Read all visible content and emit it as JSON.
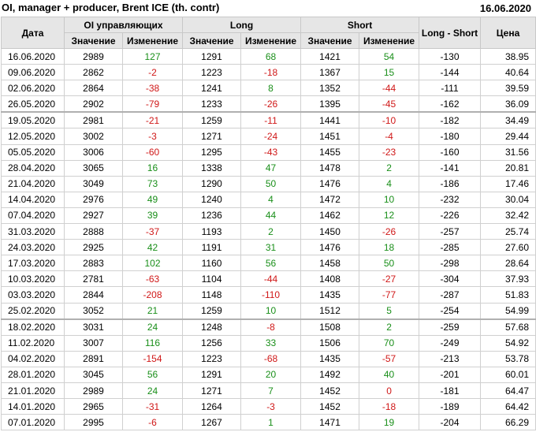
{
  "title": "OI, manager + producer, Brent ICE (th. contr)",
  "date": "16.06.2020",
  "headers": {
    "date": "Дата",
    "oi_group": "OI управляющих",
    "long_group": "Long",
    "short_group": "Short",
    "long_short": "Long - Short",
    "price": "Цена",
    "value": "Значение",
    "change": "Изменение"
  },
  "colors": {
    "positive": "#1a8f1a",
    "negative": "#d01818",
    "header_bg": "#e6e6e6"
  },
  "rows": [
    {
      "date": "16.06.2020",
      "oi": "2989",
      "oi_chg": "127",
      "long": "1291",
      "long_chg": "68",
      "short": "1421",
      "short_chg": "54",
      "ls": "-130",
      "price": "38.95"
    },
    {
      "date": "09.06.2020",
      "oi": "2862",
      "oi_chg": "-2",
      "long": "1223",
      "long_chg": "-18",
      "short": "1367",
      "short_chg": "15",
      "ls": "-144",
      "price": "40.64"
    },
    {
      "date": "02.06.2020",
      "oi": "2864",
      "oi_chg": "-38",
      "long": "1241",
      "long_chg": "8",
      "short": "1352",
      "short_chg": "-44",
      "ls": "-111",
      "price": "39.59"
    },
    {
      "date": "26.05.2020",
      "oi": "2902",
      "oi_chg": "-79",
      "long": "1233",
      "long_chg": "-26",
      "short": "1395",
      "short_chg": "-45",
      "ls": "-162",
      "price": "36.09"
    },
    {
      "date": "19.05.2020",
      "oi": "2981",
      "oi_chg": "-21",
      "long": "1259",
      "long_chg": "-11",
      "short": "1441",
      "short_chg": "-10",
      "ls": "-182",
      "price": "34.49"
    },
    {
      "date": "12.05.2020",
      "oi": "3002",
      "oi_chg": "-3",
      "long": "1271",
      "long_chg": "-24",
      "short": "1451",
      "short_chg": "-4",
      "ls": "-180",
      "price": "29.44"
    },
    {
      "date": "05.05.2020",
      "oi": "3006",
      "oi_chg": "-60",
      "long": "1295",
      "long_chg": "-43",
      "short": "1455",
      "short_chg": "-23",
      "ls": "-160",
      "price": "31.56"
    },
    {
      "date": "28.04.2020",
      "oi": "3065",
      "oi_chg": "16",
      "long": "1338",
      "long_chg": "47",
      "short": "1478",
      "short_chg": "2",
      "ls": "-141",
      "price": "20.81"
    },
    {
      "date": "21.04.2020",
      "oi": "3049",
      "oi_chg": "73",
      "long": "1290",
      "long_chg": "50",
      "short": "1476",
      "short_chg": "4",
      "ls": "-186",
      "price": "17.46"
    },
    {
      "date": "14.04.2020",
      "oi": "2976",
      "oi_chg": "49",
      "long": "1240",
      "long_chg": "4",
      "short": "1472",
      "short_chg": "10",
      "ls": "-232",
      "price": "30.04"
    },
    {
      "date": "07.04.2020",
      "oi": "2927",
      "oi_chg": "39",
      "long": "1236",
      "long_chg": "44",
      "short": "1462",
      "short_chg": "12",
      "ls": "-226",
      "price": "32.42"
    },
    {
      "date": "31.03.2020",
      "oi": "2888",
      "oi_chg": "-37",
      "long": "1193",
      "long_chg": "2",
      "short": "1450",
      "short_chg": "-26",
      "ls": "-257",
      "price": "25.74"
    },
    {
      "date": "24.03.2020",
      "oi": "2925",
      "oi_chg": "42",
      "long": "1191",
      "long_chg": "31",
      "short": "1476",
      "short_chg": "18",
      "ls": "-285",
      "price": "27.60"
    },
    {
      "date": "17.03.2020",
      "oi": "2883",
      "oi_chg": "102",
      "long": "1160",
      "long_chg": "56",
      "short": "1458",
      "short_chg": "50",
      "ls": "-298",
      "price": "28.64"
    },
    {
      "date": "10.03.2020",
      "oi": "2781",
      "oi_chg": "-63",
      "long": "1104",
      "long_chg": "-44",
      "short": "1408",
      "short_chg": "-27",
      "ls": "-304",
      "price": "37.93"
    },
    {
      "date": "03.03.2020",
      "oi": "2844",
      "oi_chg": "-208",
      "long": "1148",
      "long_chg": "-110",
      "short": "1435",
      "short_chg": "-77",
      "ls": "-287",
      "price": "51.83"
    },
    {
      "date": "25.02.2020",
      "oi": "3052",
      "oi_chg": "21",
      "long": "1259",
      "long_chg": "10",
      "short": "1512",
      "short_chg": "5",
      "ls": "-254",
      "price": "54.99"
    },
    {
      "date": "18.02.2020",
      "oi": "3031",
      "oi_chg": "24",
      "long": "1248",
      "long_chg": "-8",
      "short": "1508",
      "short_chg": "2",
      "ls": "-259",
      "price": "57.68"
    },
    {
      "date": "11.02.2020",
      "oi": "3007",
      "oi_chg": "116",
      "long": "1256",
      "long_chg": "33",
      "short": "1506",
      "short_chg": "70",
      "ls": "-249",
      "price": "54.92"
    },
    {
      "date": "04.02.2020",
      "oi": "2891",
      "oi_chg": "-154",
      "long": "1223",
      "long_chg": "-68",
      "short": "1435",
      "short_chg": "-57",
      "ls": "-213",
      "price": "53.78"
    },
    {
      "date": "28.01.2020",
      "oi": "3045",
      "oi_chg": "56",
      "long": "1291",
      "long_chg": "20",
      "short": "1492",
      "short_chg": "40",
      "ls": "-201",
      "price": "60.01"
    },
    {
      "date": "21.01.2020",
      "oi": "2989",
      "oi_chg": "24",
      "long": "1271",
      "long_chg": "7",
      "short": "1452",
      "short_chg": "0",
      "ls": "-181",
      "price": "64.47"
    },
    {
      "date": "14.01.2020",
      "oi": "2965",
      "oi_chg": "-31",
      "long": "1264",
      "long_chg": "-3",
      "short": "1452",
      "short_chg": "-18",
      "ls": "-189",
      "price": "64.42"
    },
    {
      "date": "07.01.2020",
      "oi": "2995",
      "oi_chg": "-6",
      "long": "1267",
      "long_chg": "1",
      "short": "1471",
      "short_chg": "19",
      "ls": "-204",
      "price": "66.29"
    }
  ]
}
